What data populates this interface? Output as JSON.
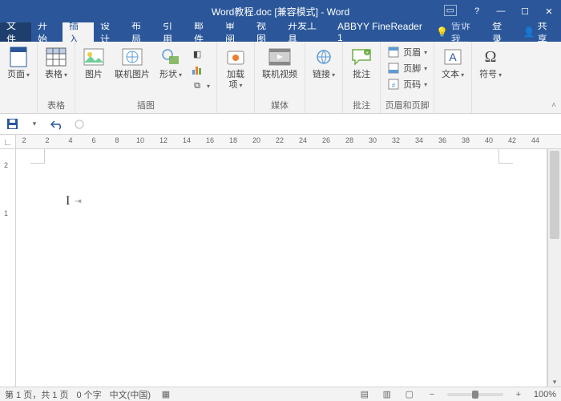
{
  "title": "Word教程.doc [兼容模式] - Word",
  "menu": {
    "file": "文件",
    "home": "开始",
    "insert": "插入",
    "design": "设计",
    "layout": "布局",
    "references": "引用",
    "mailings": "邮件",
    "review": "审阅",
    "view": "视图",
    "developer": "开发工具",
    "abbyy": "ABBYY FineReader 1",
    "tell": "告诉我...",
    "login": "登录",
    "share": "共享"
  },
  "ribbon": {
    "pages": {
      "cover": "页面",
      "group": "表格"
    },
    "tables": {
      "btn": "表格",
      "group": "表格"
    },
    "illus": {
      "pic": "图片",
      "online": "联机图片",
      "shapes": "形状",
      "group": "插图"
    },
    "addins": {
      "btn": "加载\n项",
      "group": ""
    },
    "media": {
      "btn": "联机视频",
      "group": "媒体"
    },
    "links": {
      "btn": "链接",
      "group": ""
    },
    "comments": {
      "btn": "批注",
      "group": "批注"
    },
    "hf": {
      "header": "页眉",
      "footer": "页脚",
      "number": "页码",
      "group": "页眉和页脚"
    },
    "text": {
      "btn": "文本",
      "group": ""
    },
    "symbols": {
      "btn": "符号",
      "group": ""
    }
  },
  "ruler": [
    "2",
    "2",
    "4",
    "6",
    "8",
    "10",
    "12",
    "14",
    "16",
    "18",
    "20",
    "22",
    "24",
    "26",
    "28",
    "30",
    "32",
    "34",
    "36",
    "38",
    "40",
    "42",
    "44"
  ],
  "rulerV": [
    "2",
    "1"
  ],
  "status": {
    "page": "第 1 页，共 1 页",
    "words": "0 个字",
    "lang": "中文(中国)",
    "zoom": "100%"
  }
}
